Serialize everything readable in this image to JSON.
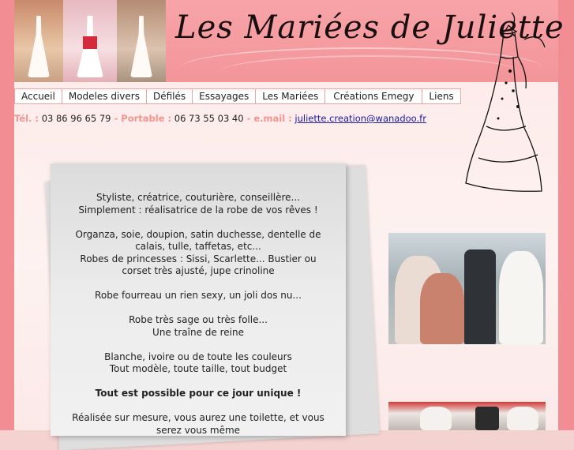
{
  "header": {
    "title": "Les Mariées de Juliette"
  },
  "nav": {
    "items": [
      "Accueil",
      "Modeles divers",
      "Défilés",
      "Essayages",
      "Les Mariées",
      "Créations Emegy",
      "Liens"
    ]
  },
  "contact": {
    "tel_label": "Tél. :",
    "tel": "03 86 96 65 79",
    "sep1": " - ",
    "portable_label": "Portable",
    "colon": " :",
    "portable": "06 73 55 03 40",
    "sep2": " - ",
    "email_label": "e.mail :",
    "email": "juliette.creation@wanadoo.fr"
  },
  "content": {
    "p1_l1": "Styliste, créatrice, couturière, conseillère...",
    "p1_l2": "Simplement : réalisatrice de la robe de vos rêves !",
    "p2_l1": "Organza, soie, doupion, satin duchesse, dentelle de",
    "p2_l2": "calais, tulle, taffetas, etc...",
    "p2_l3": "Robes de princesses : Sissi, Scarlette... Bustier ou",
    "p2_l4": "corset très ajusté, jupe crinoline",
    "p3": "Robe fourreau un rien sexy, un joli dos nu...",
    "p4_l1": "Robe très sage ou très folle...",
    "p4_l2": "Une traîne de reine",
    "p5_l1": "Blanche, ivoire ou de toute les couleurs",
    "p5_l2": "Tout modèle, toute taille, tout budget",
    "p6": "Tout est possible pour ce jour unique !",
    "p7_l1": "Réalisée sur mesure, vous aurez une toilette, et vous",
    "p7_l2": "serez vous même"
  },
  "colors": {
    "accent_pink": "#f28d94",
    "label_salmon": "#f4948f",
    "link_blue": "#1a1aa6"
  }
}
